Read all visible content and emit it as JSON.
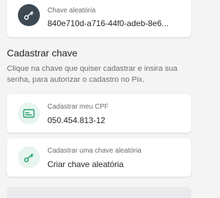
{
  "registered_key": {
    "label": "Chave aleatória",
    "value": "840e710d-a716-44f0-adeb-8e6..."
  },
  "register_section": {
    "title": "Cadastrar chave",
    "description": "Clique na chave que quiser cadastrar e insira sua senha, para autorizar o cadastro no Pix."
  },
  "options": {
    "cpf": {
      "label": "Cadastrar meu CPF",
      "value": "050.454.813-12"
    },
    "random": {
      "label": "Cadastrar uma chave aleatória",
      "value": "Criar chave aleatória"
    }
  },
  "colors": {
    "accent": "#1f9e6e",
    "dark_icon_bg": "#3d4a53",
    "light_icon_bg": "#e8f5ef"
  },
  "icons": {
    "registered_key": "key-icon",
    "cpf": "id-card-icon",
    "random": "key-icon"
  }
}
